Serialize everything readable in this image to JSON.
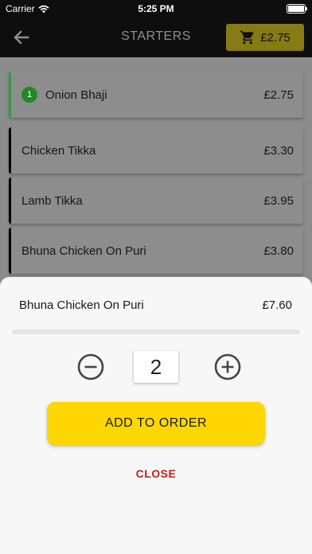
{
  "status_bar": {
    "carrier": "Carrier",
    "time": "5:25 PM"
  },
  "nav": {
    "title": "STARTERS",
    "cart_total": "£2.75"
  },
  "items": [
    {
      "name": "Onion Bhaji",
      "price": "£2.75",
      "qty": "1"
    },
    {
      "name": "Chicken Tikka",
      "price": "£3.30"
    },
    {
      "name": "Lamb Tikka",
      "price": "£3.95"
    },
    {
      "name": "Bhuna Chicken On Puri",
      "price": "£3.80"
    }
  ],
  "sheet": {
    "item_name": "Bhuna Chicken On Puri",
    "item_total": "£7.60",
    "quantity": "2",
    "add_label": "ADD TO ORDER",
    "close_label": "CLOSE"
  },
  "colors": {
    "accent": "#fed600",
    "close": "#c41e1e",
    "active_border": "#2ea043"
  }
}
